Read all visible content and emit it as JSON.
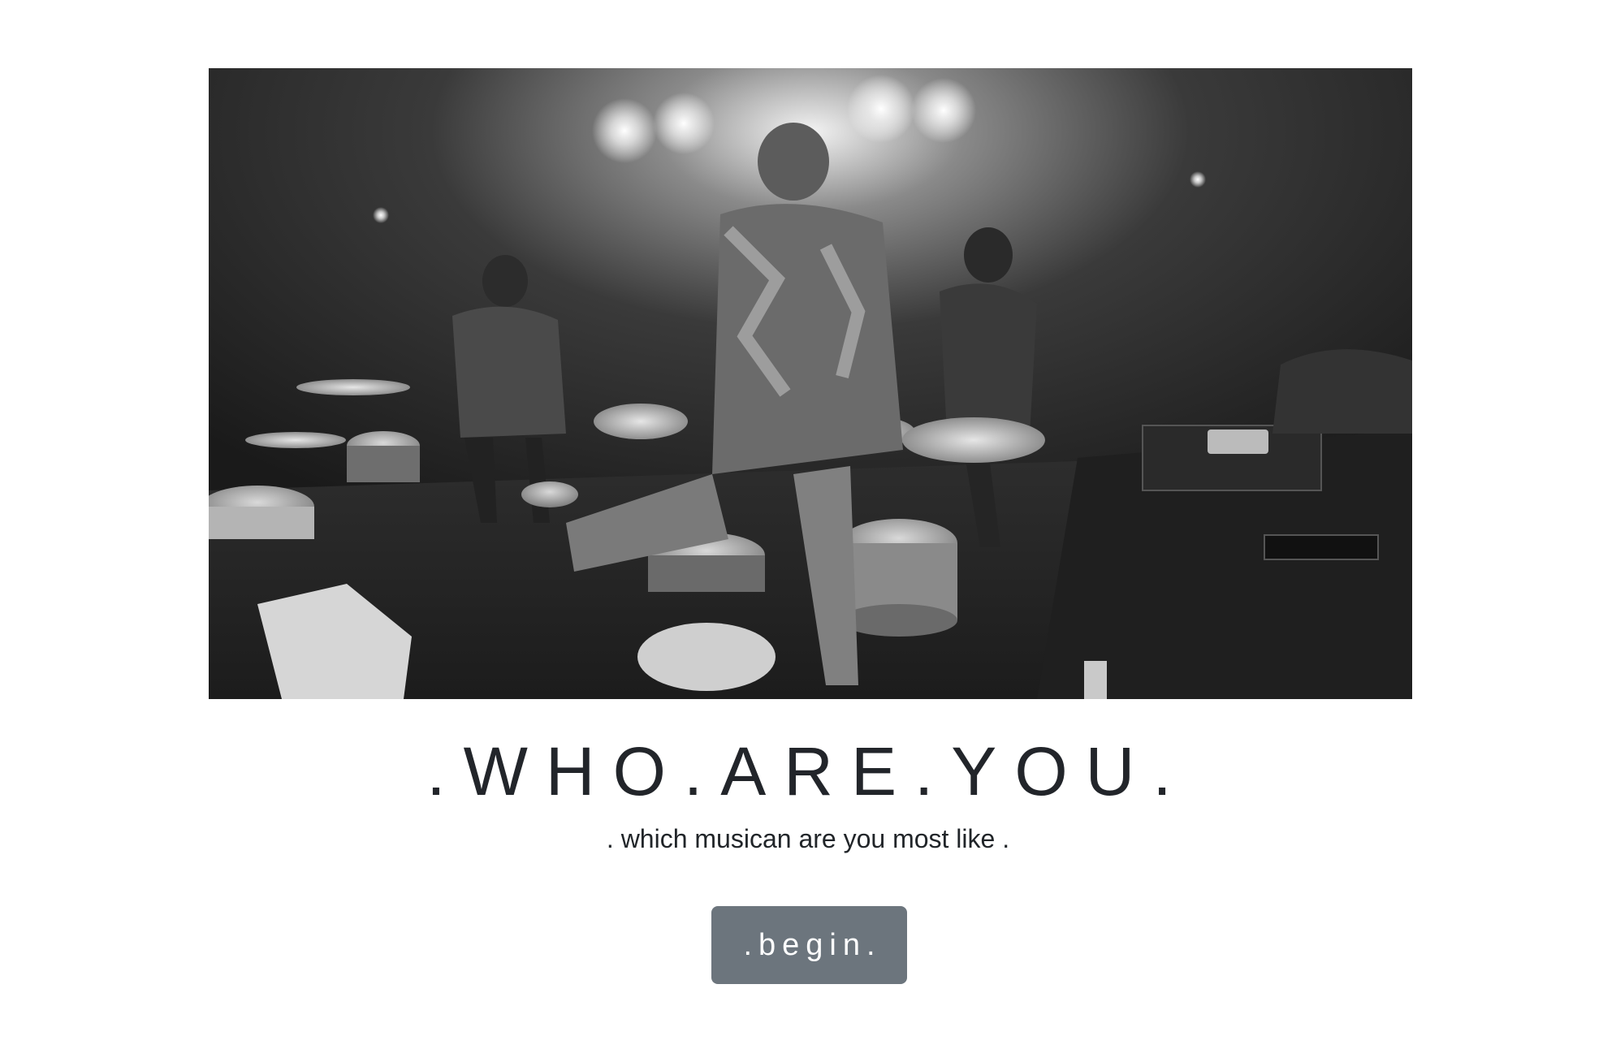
{
  "hero": {
    "image_description_icon": "band-on-stage-photo",
    "image_alt": ""
  },
  "heading": {
    "title": ".WHO.ARE.YOU.",
    "subtitle": ". which musican are you most like ."
  },
  "actions": {
    "begin_label": ".begin."
  },
  "colors": {
    "button_bg": "#6c757d",
    "button_text": "#ffffff",
    "title_text": "#22252a",
    "background": "#ffffff"
  }
}
